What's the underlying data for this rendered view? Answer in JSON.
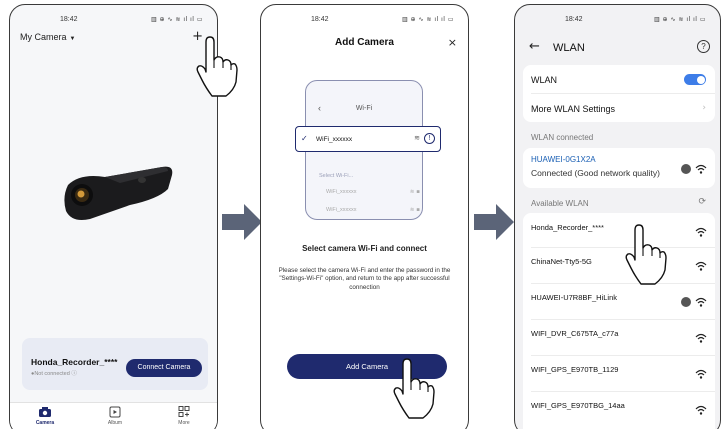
{
  "status_bar": {
    "time": "18:42",
    "icons": "▥ ⊕ ∿ ≋ ıl ıl ▭"
  },
  "screen1": {
    "camera_selector": "My Camera",
    "add_icon": "+",
    "device": {
      "name": "Honda_Recorder_****",
      "status": "●Not connected ⓘ"
    },
    "connect_button": "Connect Camera",
    "tabs": [
      {
        "label": "Camera"
      },
      {
        "label": "Album"
      },
      {
        "label": "More"
      }
    ]
  },
  "screen2": {
    "title": "Add Camera",
    "close_icon": "×",
    "illustration": {
      "header": "Wi-Fi",
      "selected_ssid": "WiFi_xxxxxx",
      "sub_label": "Select Wi-Fi...",
      "other_ssids": [
        "WiFi_xxxxxx",
        "WiFi_xxxxxx"
      ]
    },
    "heading": "Select camera Wi-Fi and connect",
    "body": "Please select the camera Wi-Fi and enter the password in the \"Settings-Wi-Fi\" option, and return to the app after successful connection",
    "add_button": "Add Camera"
  },
  "screen3": {
    "title": "WLAN",
    "help_icon": "?",
    "wlan_toggle_label": "WLAN",
    "wlan_enabled": true,
    "more_settings": "More WLAN Settings",
    "connected_section": "WLAN connected",
    "connected_network": {
      "name": "HUAWEI-0G1X2A",
      "status": "Connected (Good network quality)"
    },
    "available_section": "Available WLAN",
    "networks": [
      {
        "name": "Honda_Recorder_****",
        "locked": false
      },
      {
        "name": "ChinaNet-Tty5-5G",
        "locked": false
      },
      {
        "name": "HUAWEI-U7R8BF_HiLink",
        "locked": true
      },
      {
        "name": "WIFI_DVR_C675TA_c77a",
        "locked": false
      },
      {
        "name": "WIFI_GPS_E970TB_1129",
        "locked": false
      },
      {
        "name": "WIFI_GPS_E970TBG_14aa",
        "locked": false
      }
    ]
  },
  "colors": {
    "brand": "#1f2a6e",
    "accent": "#3d7de8",
    "arrow": "#5b6478",
    "link": "#1a5fb4"
  }
}
